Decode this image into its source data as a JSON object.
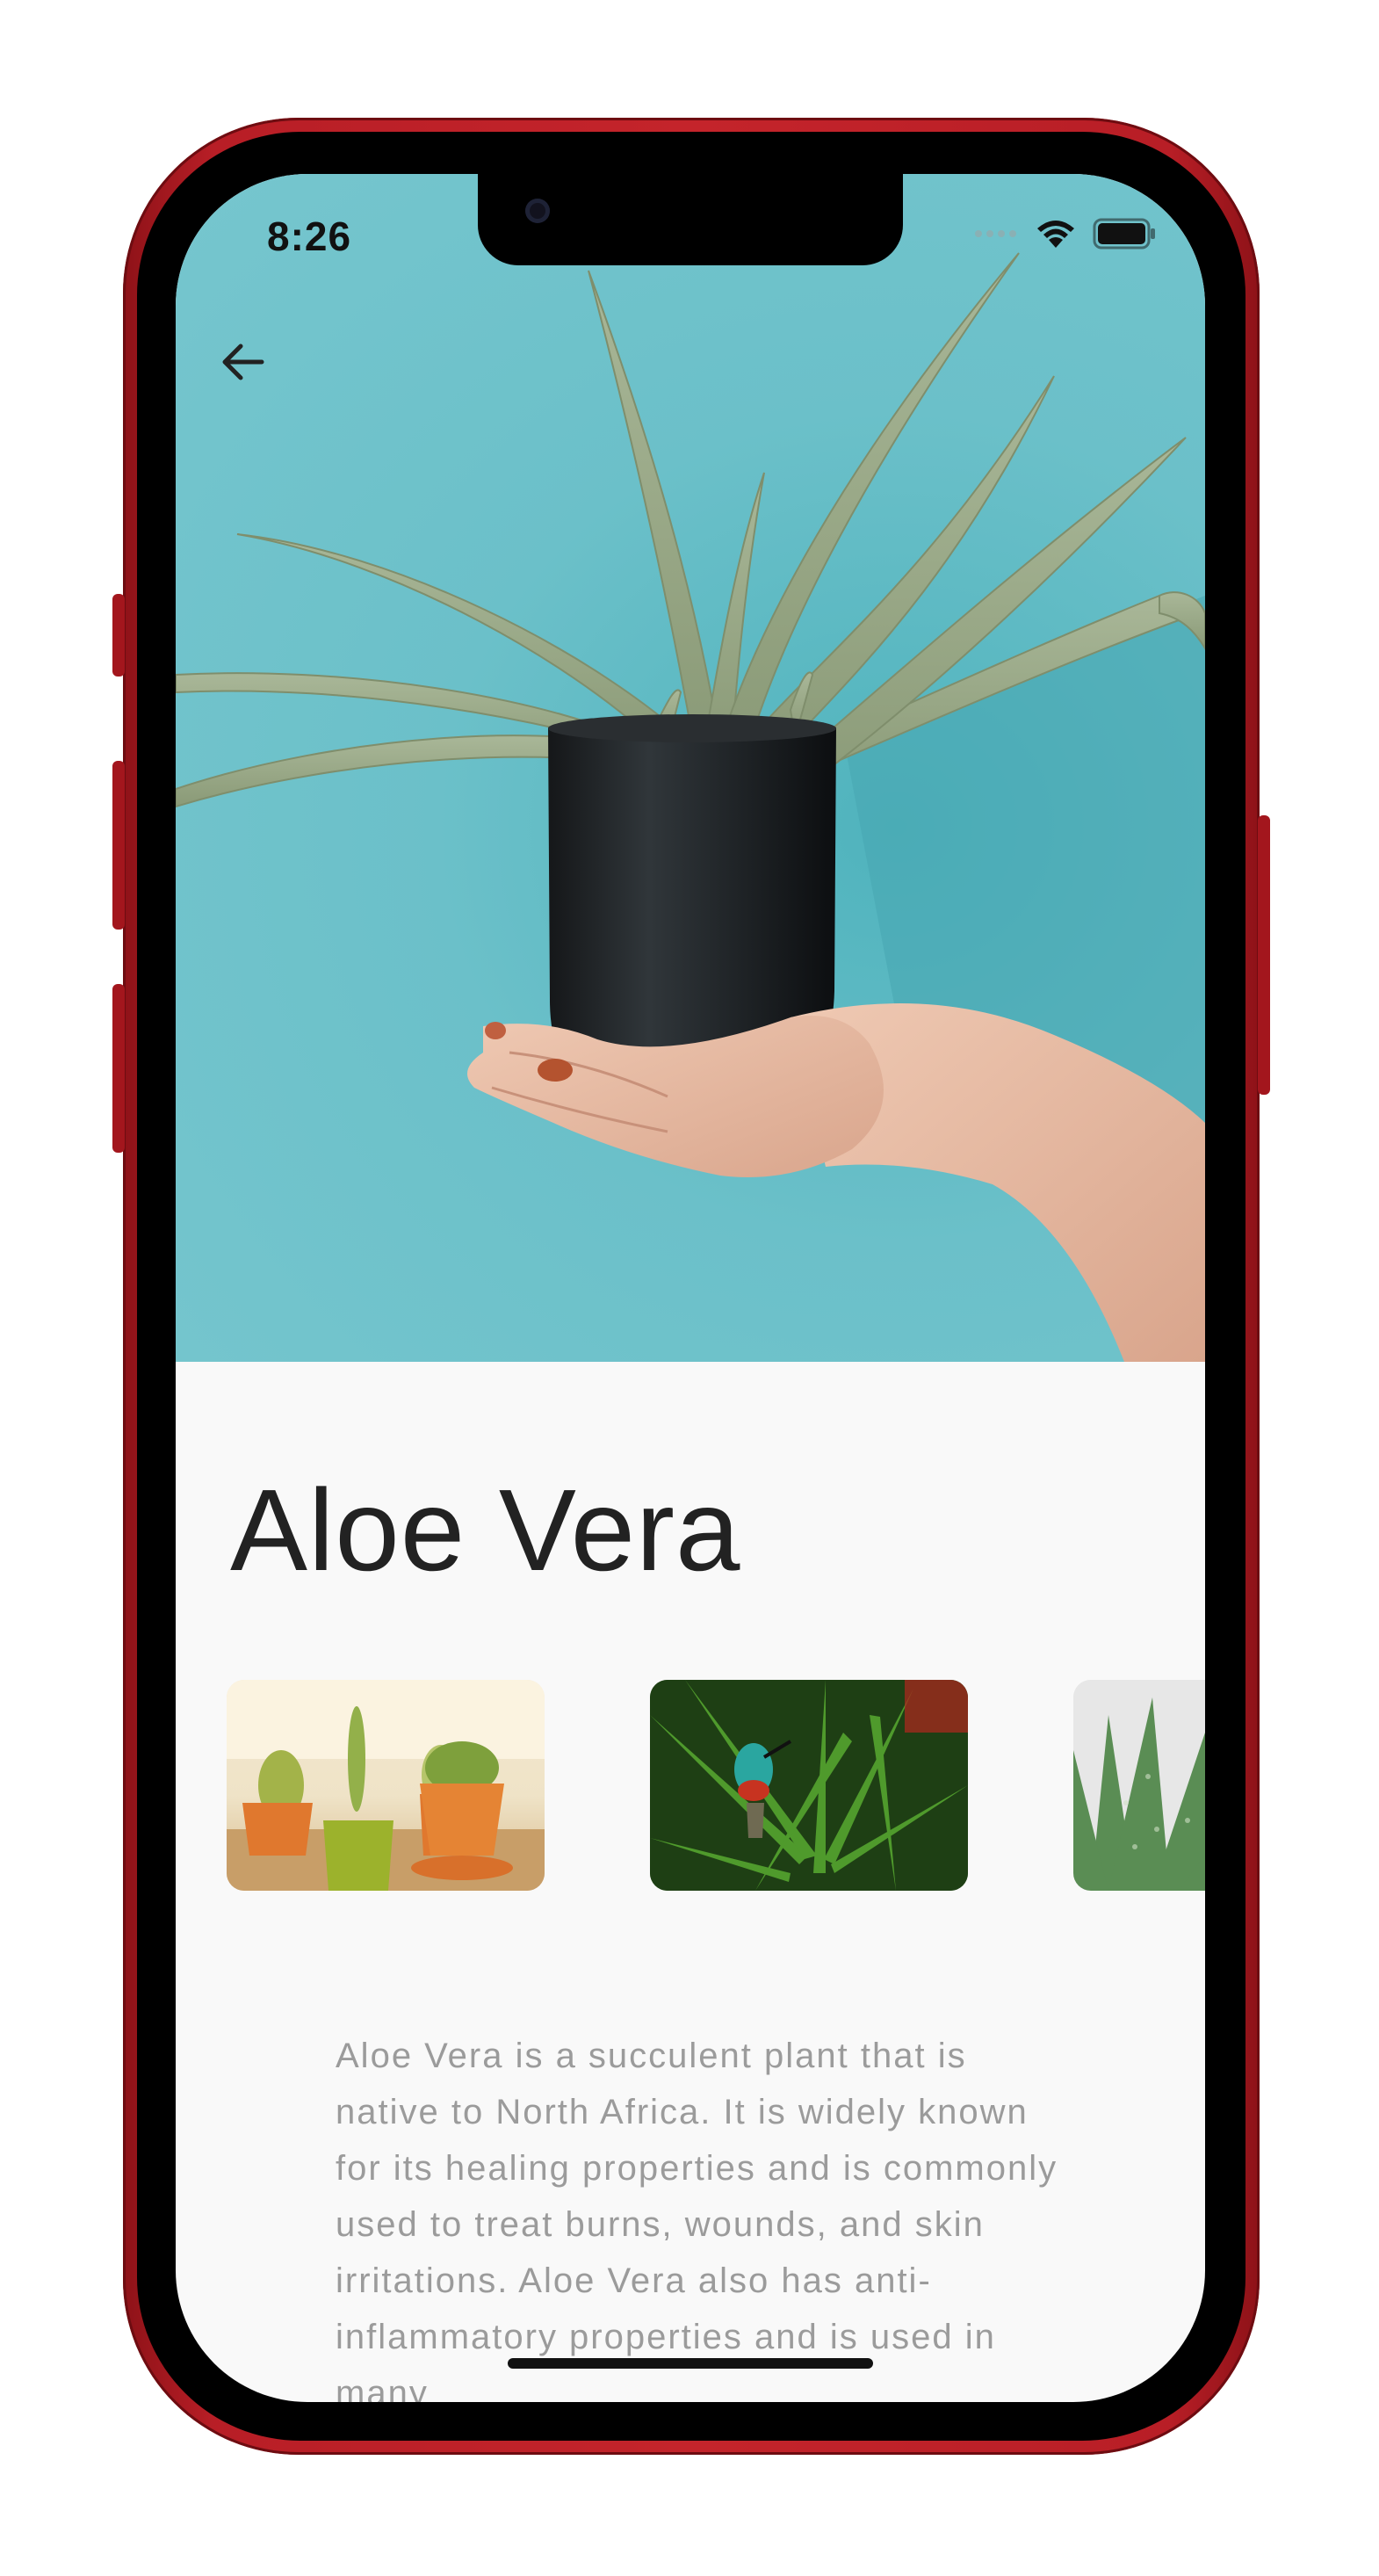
{
  "status_bar": {
    "time": "8:26",
    "icons": [
      "signal-icon",
      "wifi-icon",
      "battery-icon"
    ]
  },
  "navigation": {
    "back_icon": "arrow-left-icon"
  },
  "plant": {
    "name": "Aloe Vera",
    "description": "Aloe Vera is a succulent plant that is native to North Africa. It is widely known for its healing properties and is commonly used to treat burns, wounds, and skin irritations. Aloe Vera also has anti-inflammatory properties and is used in many"
  },
  "gallery": {
    "thumbnails": [
      "potted-cacti-image",
      "aloe-hummingbird-image",
      "aloe-closeup-image"
    ]
  },
  "colors": {
    "hero_background": "#6bc0c9",
    "title_text": "#222222",
    "body_text": "#9b9b9b",
    "phone_frame": "#c4242b"
  }
}
